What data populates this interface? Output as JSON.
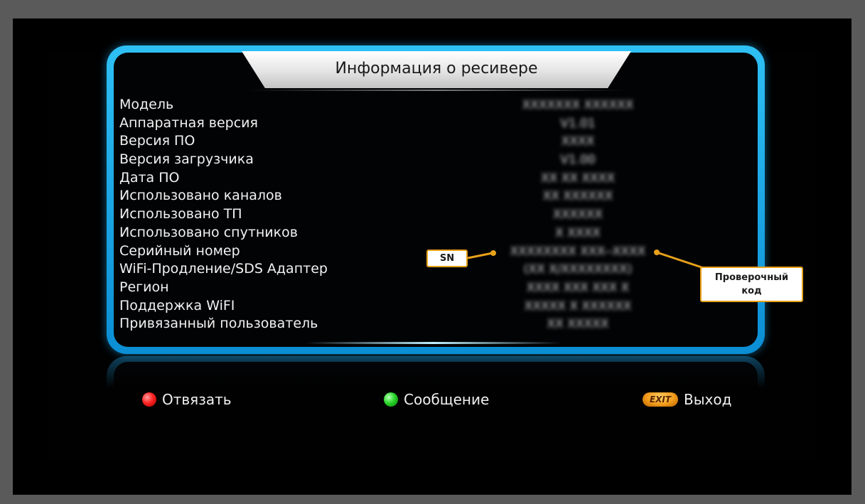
{
  "title": "Информация о ресивере",
  "info": [
    {
      "label": "Модель",
      "value": "XXXXXXX XXXXXX"
    },
    {
      "label": "Аппаратная версия",
      "value": "V1.01"
    },
    {
      "label": "Версия ПО",
      "value": "XXXX"
    },
    {
      "label": "Версия загрузчика",
      "value": "V1.00"
    },
    {
      "label": "Дата ПО",
      "value": "XX XX XXXX"
    },
    {
      "label": "Использовано каналов",
      "value": "XX XXXXXX"
    },
    {
      "label": "Использовано ТП",
      "value": "XXXXXX"
    },
    {
      "label": "Использовано спутников",
      "value": "X XXXX"
    },
    {
      "label": "Серийный номер",
      "value": "XXXXXXXX XXX--XXXX"
    },
    {
      "label": "WiFi-Продление/SDS Адаптер",
      "value": "(XX X/XXXXXXXX)"
    },
    {
      "label": "Регион",
      "value": "XXXX XXX XXX X"
    },
    {
      "label": "Поддержка WiFI",
      "value": "XXXXX X XXXXXX"
    },
    {
      "label": "Привязанный пользователь",
      "value": "XX XXXXX"
    }
  ],
  "callouts": {
    "sn": "SN",
    "code_line1": "Проверочный",
    "code_line2": "код"
  },
  "footer": {
    "red_label": "Отвязать",
    "green_label": "Сообщение",
    "exit_key": "EXIT",
    "exit_label": "Выход"
  },
  "colors": {
    "frame": "#1aa6e8",
    "callout_border": "#e8a21a",
    "red_button": "#ff2323",
    "green_button": "#29d629",
    "exit_button": "#f19a1a"
  }
}
